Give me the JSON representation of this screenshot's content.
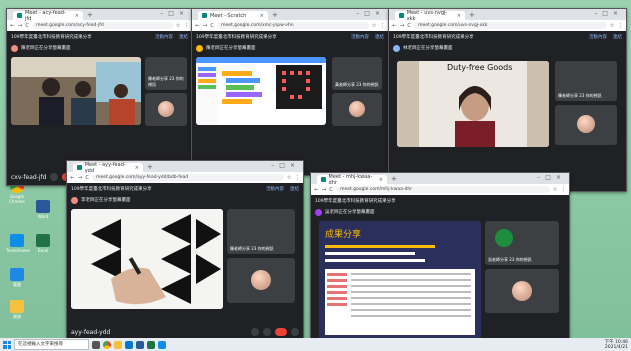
{
  "desktop": {
    "icons": [
      {
        "label": "Google Chrome"
      },
      {
        "label": "Word"
      },
      {
        "label": "TeamViewer"
      },
      {
        "label": "Excel"
      },
      {
        "label": "電腦"
      },
      {
        "label": "資源"
      }
    ]
  },
  "windows": [
    {
      "tab_title": "Meet - acy-fead-jfd",
      "url": "meet.google.com/acy-fead-jfd",
      "meet_title": "109學年度臺北市科技教育研究成果分享",
      "links": [
        "活動內容",
        "連結"
      ],
      "presenter": "陳老師正在分享螢幕畫面",
      "tiles": [
        {
          "label": "陳老師分享 23 你的視訊"
        },
        {
          "label": ""
        }
      ],
      "self_label": "cxv-fead-jfd"
    },
    {
      "tab_title": "Meet - Scratch",
      "url": "meet.google.com/xmc-jnpw-vhn",
      "meet_title": "109學年度臺北市科技教育研究成果分享",
      "links": [
        "活動內容",
        "連結"
      ],
      "presenter": "陳老師正在分享螢幕畫面",
      "tiles": [
        {
          "label": "黃老師分享 23 你的視訊"
        },
        {
          "label": ""
        }
      ]
    },
    {
      "tab_title": "Meet - uvs-nvgj-xkk",
      "url": "meet.google.com/uvs-nvgj-xkk",
      "meet_title": "109學年度臺北市科技教育研究成果分享",
      "links": [
        "活動內容",
        "連結"
      ],
      "presenter": "林老師正在分享螢幕畫面",
      "tiles": [
        {
          "label": "陳老師分享 23 你的視訊"
        },
        {
          "label": ""
        }
      ],
      "slide_caption": "Duty-free Goods"
    },
    {
      "tab_title": "Meet - ayy-fead-ydd",
      "url": "meet.google.com/ayy-fead-ydd/bdb-fead",
      "meet_title": "109學年度臺北市科技教育研究成果分享",
      "links": [
        "活動內容",
        "連結"
      ],
      "presenter": "李老師正在分享螢幕畫面",
      "tiles": [
        {
          "label": "陳老師分享 23 你的視訊"
        },
        {
          "label": ""
        }
      ],
      "self_label": "ayy-fead-ydd"
    },
    {
      "tab_title": "Meet - mhj-kwaa-dhr",
      "url": "meet.google.com/mhj-kwaa-dhr",
      "meet_title": "109學年度臺北市科技教育研究成果分享",
      "links": [
        "活動內容",
        "連結"
      ],
      "presenter": "吳老師正在分享螢幕畫面",
      "tiles": [
        {
          "label": "吳老師分享 23 你的視訊"
        },
        {
          "label": ""
        }
      ],
      "slide_heading": "成果分享"
    }
  ],
  "taskbar": {
    "search_placeholder": "在這裡輸入文字來搜尋",
    "time": "下午 10:46",
    "date": "2021/4/21"
  }
}
